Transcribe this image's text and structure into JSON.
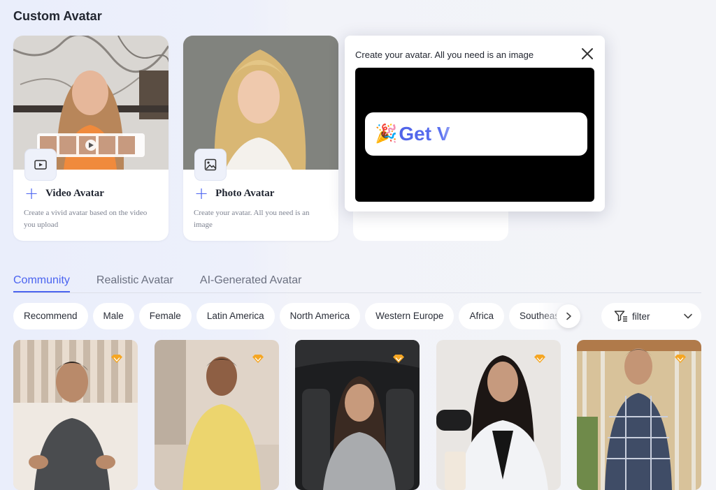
{
  "page": {
    "title": "Custom Avatar"
  },
  "custom_cards": [
    {
      "title": "Video Avatar",
      "description": "Create a vivid avatar based on the video you upload",
      "icon": "video-play-icon"
    },
    {
      "title": "Photo Avatar",
      "description": "Create your avatar. All you need is an image",
      "icon": "image-icon"
    }
  ],
  "popup": {
    "title": "Create your avatar. All you need is an image",
    "video_text": "Get V",
    "emoji": "🎉"
  },
  "tabs": [
    {
      "label": "Community",
      "active": true
    },
    {
      "label": "Realistic Avatar",
      "active": false
    },
    {
      "label": "AI-Generated Avatar",
      "active": false
    }
  ],
  "chips": [
    "Recommend",
    "Male",
    "Female",
    "Latin America",
    "North America",
    "Western Europe",
    "Africa",
    "Southeast Asia"
  ],
  "filter": {
    "label": "filter"
  },
  "colors": {
    "accent": "#4a63f0",
    "premium_badge": "#f5a623"
  },
  "avatars": [
    {
      "premium": true
    },
    {
      "premium": true
    },
    {
      "premium": true
    },
    {
      "premium": true
    },
    {
      "premium": true
    }
  ]
}
